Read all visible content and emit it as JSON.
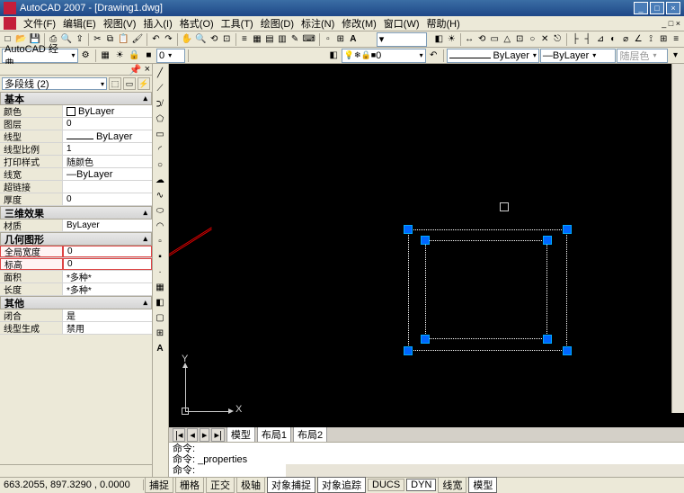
{
  "titlebar": {
    "title": "AutoCAD 2007 - [Drawing1.dwg]"
  },
  "menu": {
    "file": "文件(F)",
    "edit": "编辑(E)",
    "view": "视图(V)",
    "insert": "插入(I)",
    "format": "格式(O)",
    "tools": "工具(T)",
    "draw": "绘图(D)",
    "dimension": "标注(N)",
    "modify": "修改(M)",
    "window": "窗口(W)",
    "help": "帮助(H)"
  },
  "toolbars": {
    "workspace": "AutoCAD 经典",
    "layer_indicator": "0",
    "layer": "0",
    "linetype_label": "ByLayer",
    "lineweight_label": "ByLayer",
    "color_label": "随层色"
  },
  "props": {
    "selector": "多段线 (2)",
    "sec_basic": "基本",
    "color_lbl": "颜色",
    "color_val": "ByLayer",
    "layer_lbl": "图层",
    "layer_val": "0",
    "ltype_lbl": "线型",
    "ltype_val": "ByLayer",
    "ltscale_lbl": "线型比例",
    "ltscale_val": "1",
    "plotstyle_lbl": "打印样式",
    "plotstyle_val": "随颜色",
    "lweight_lbl": "线宽",
    "lweight_val": "ByLayer",
    "hyperlink_lbl": "超链接",
    "hyperlink_val": "",
    "thick_lbl": "厚度",
    "thick_val": "0",
    "sec_3d": "三维效果",
    "material_lbl": "材质",
    "material_val": "ByLayer",
    "sec_geom": "几何图形",
    "globalw_lbl": "全局宽度",
    "globalw_val": "0",
    "elev_lbl": "标高",
    "elev_val": "0",
    "area_lbl": "面积",
    "area_val": "*多种*",
    "length_lbl": "长度",
    "length_val": "*多种*",
    "sec_misc": "其他",
    "closed_lbl": "闭合",
    "closed_val": "是",
    "ltgen_lbl": "线型生成",
    "ltgen_val": "禁用"
  },
  "tabs": {
    "model": "模型",
    "layout1": "布局1",
    "layout2": "布局2"
  },
  "cmdline": {
    "l1": "命令:",
    "l2": "命令: _properties",
    "l3": "命令:"
  },
  "status": {
    "coords": "663.2055, 897.3290 , 0.0000",
    "snap": "捕捉",
    "grid": "栅格",
    "ortho": "正交",
    "polar": "极轴",
    "osnap": "对象捕捉",
    "otrack": "对象追踪",
    "ducs": "DUCS",
    "dyn": "DYN",
    "lwt": "线宽",
    "model": "模型"
  },
  "ucs": {
    "x": "X",
    "y": "Y"
  }
}
